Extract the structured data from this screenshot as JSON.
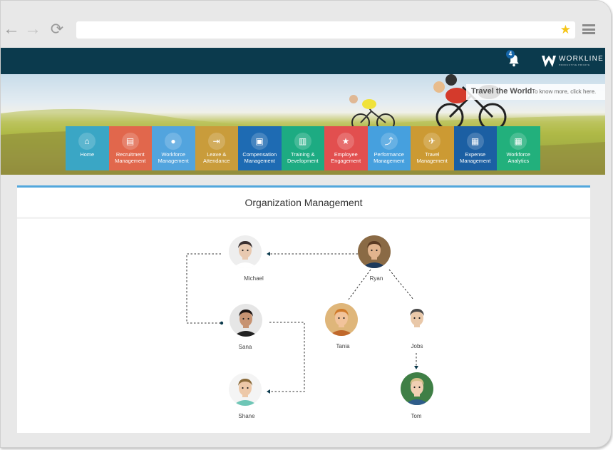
{
  "browser": {
    "address": "",
    "back": "←",
    "forward": "→",
    "reload": "⟳",
    "bookmark": "★"
  },
  "header": {
    "notification_count": "4",
    "logo_text": "WORKLINE",
    "logo_tagline": "PRODUCTIVE PRIVATE"
  },
  "banner": {
    "title": "Travel the World",
    "subtitle": "To know more, click here."
  },
  "modules": [
    {
      "label_1": "Home",
      "label_2": "",
      "icon": "home-icon",
      "glyph": "⌂",
      "color": "#3aa6c5"
    },
    {
      "label_1": "Recruitment",
      "label_2": "Management",
      "icon": "document-icon",
      "glyph": "▤",
      "color": "#e1674c"
    },
    {
      "label_1": "Workforce",
      "label_2": "Management",
      "icon": "user-icon",
      "glyph": "●",
      "color": "#52a4de"
    },
    {
      "label_1": "Leave &",
      "label_2": "Attendance",
      "icon": "sign-in-icon",
      "glyph": "⇥",
      "color": "#c99c3b"
    },
    {
      "label_1": "Compensation",
      "label_2": "Management",
      "icon": "money-icon",
      "glyph": "▣",
      "color": "#1e6bb3"
    },
    {
      "label_1": "Training &",
      "label_2": "Development",
      "icon": "book-icon",
      "glyph": "▥",
      "color": "#1dab82"
    },
    {
      "label_1": "Employee",
      "label_2": "Engagement",
      "icon": "star-icon",
      "glyph": "★",
      "color": "#e24f4f"
    },
    {
      "label_1": "Performance",
      "label_2": "Management",
      "icon": "chart-icon",
      "glyph": "⤴",
      "color": "#46a0de"
    },
    {
      "label_1": "Travel",
      "label_2": "Management",
      "icon": "plane-icon",
      "glyph": "✈",
      "color": "#cc9a33"
    },
    {
      "label_1": "Expense",
      "label_2": "Management",
      "icon": "calculator-icon",
      "glyph": "▦",
      "color": "#1b5fa3"
    },
    {
      "label_1": "Workforce",
      "label_2": "Analytics",
      "icon": "calculator-icon",
      "glyph": "▦",
      "color": "#22b07c"
    }
  ],
  "panel": {
    "title": "Organization Management"
  },
  "people": {
    "michael": {
      "name": "Michael",
      "skin": "#e8c9b0",
      "hair": "#3a3030",
      "shirt": "#ffffff",
      "bg": "#eeeeee"
    },
    "ryan": {
      "name": "Ryan",
      "skin": "#e2b48e",
      "hair": "#5a3a22",
      "shirt": "#1d3a5c",
      "bg": "#8a6a45"
    },
    "sana": {
      "name": "Sana",
      "skin": "#c79372",
      "hair": "#1e1614",
      "shirt": "#222222",
      "bg": "#e6e6e6"
    },
    "tania": {
      "name": "Tania",
      "skin": "#f2c39b",
      "hair": "#d07a2a",
      "shirt": "#c0682b",
      "bg": "#dfb67a"
    },
    "jobs": {
      "name": "Jobs",
      "skin": "#e9c8a9",
      "hair": "#4a4a4a",
      "shirt": "#ffffff",
      "bg": "#ffffff"
    },
    "shane": {
      "name": "Shane",
      "skin": "#edc8a8",
      "hair": "#8b6b3a",
      "shirt": "#6ec6b6",
      "bg": "#f4f4f4"
    },
    "tom": {
      "name": "Tom",
      "skin": "#f1cfb3",
      "hair": "#d6c08a",
      "shirt": "#2f5d8a",
      "bg": "#3f7f46"
    }
  }
}
